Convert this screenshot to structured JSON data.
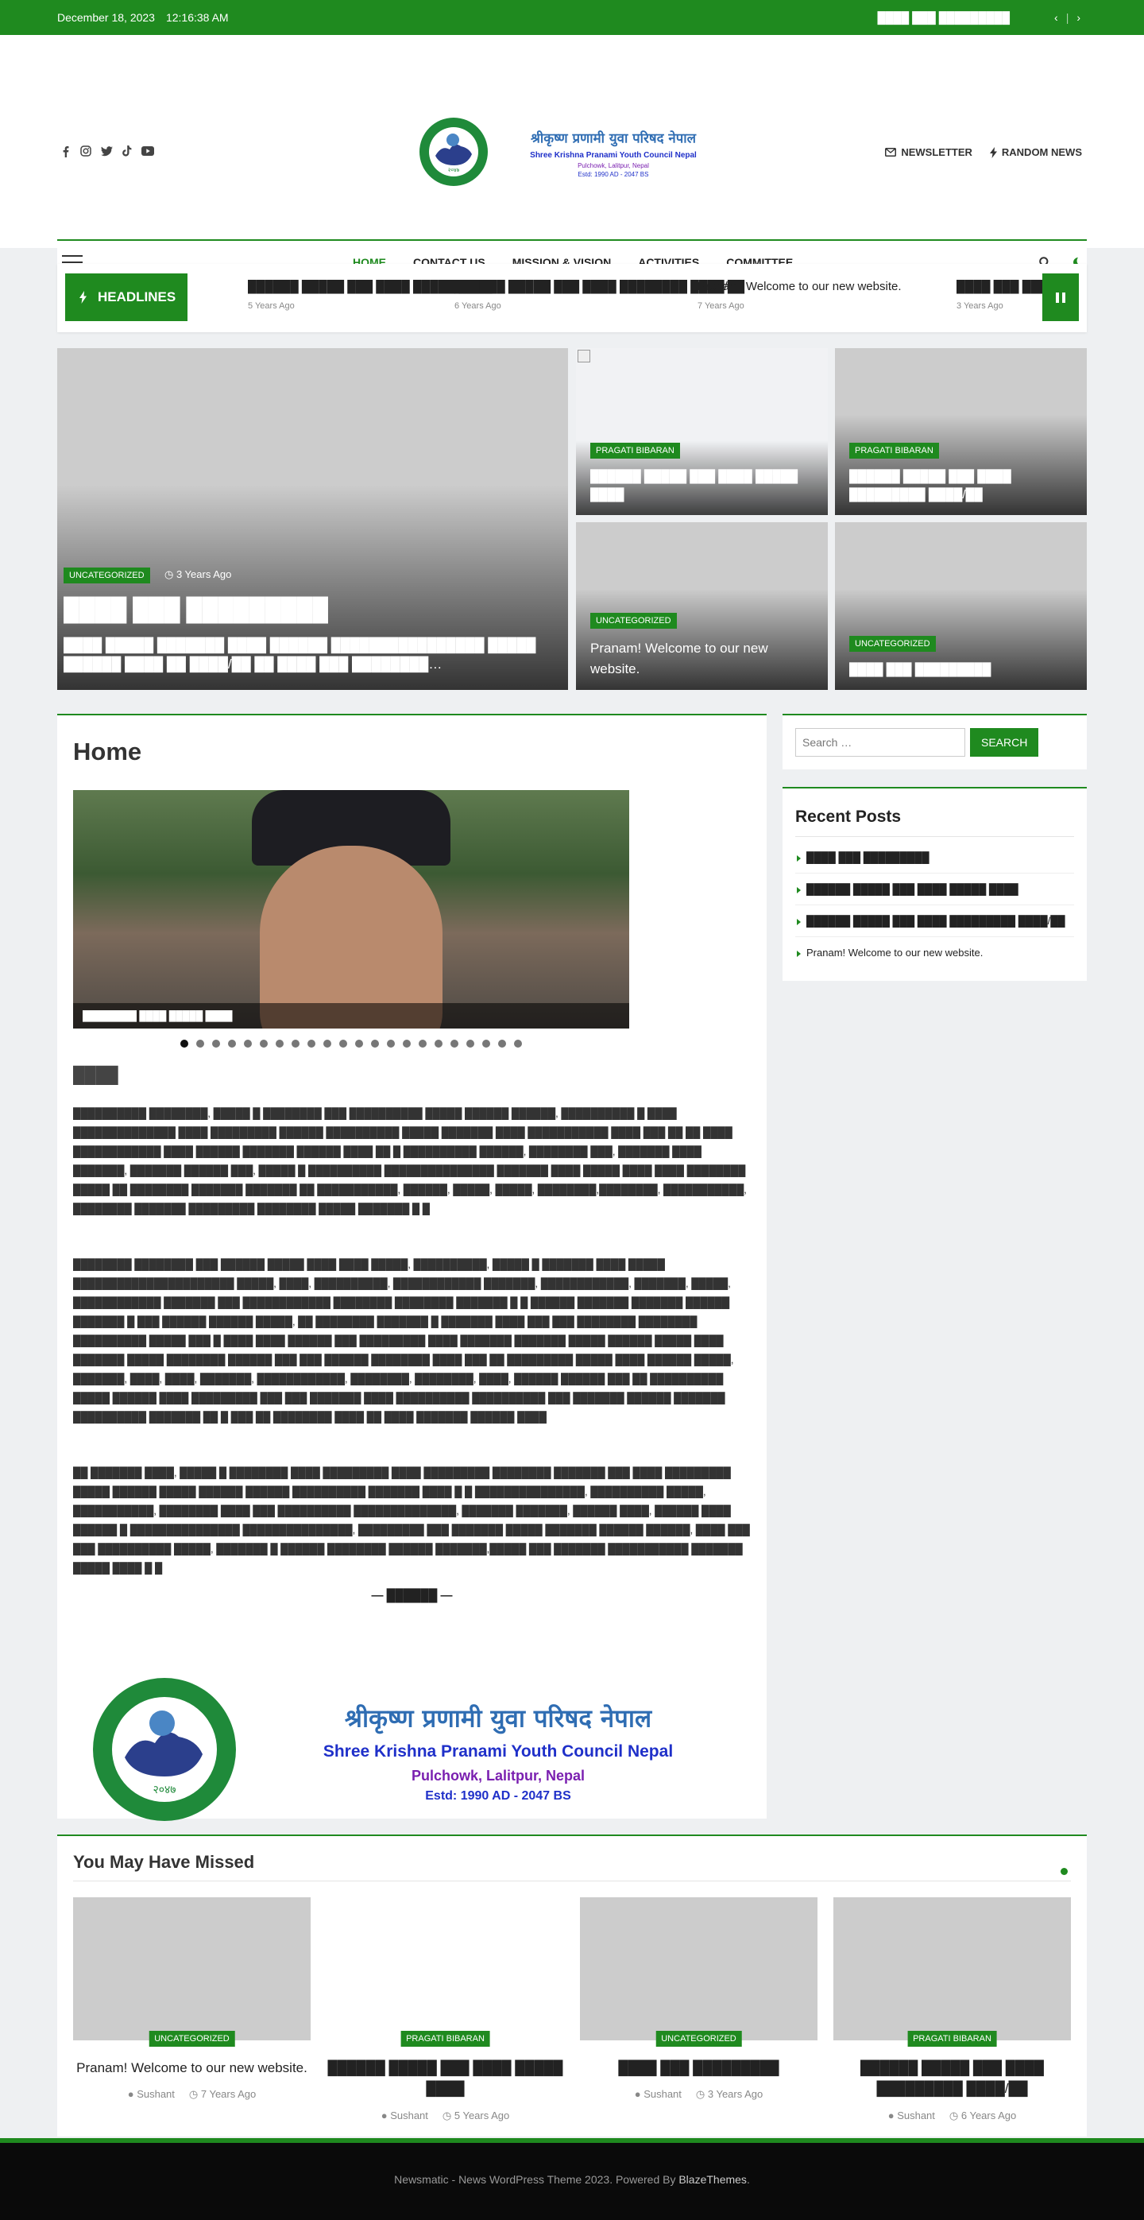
{
  "topbar": {
    "date": "December 18, 2023",
    "time": "12:16:38 AM",
    "ticker_text": "████ ███ █████████"
  },
  "header": {
    "social": [
      "facebook-icon",
      "instagram-icon",
      "twitter-icon",
      "tiktok-icon",
      "youtube-icon"
    ],
    "logo": {
      "title_np": "श्रीकृष्ण प्रणामी युवा परिषद नेपाल",
      "title_en": "Shree Krishna Pranami Youth Council Nepal",
      "address": "Pulchowk, Lalitpur, Nepal",
      "estd": "Estd: 1990 AD - 2047 BS",
      "seal_year": "२०४७"
    },
    "newsletter": "NEWSLETTER",
    "random_news": "RANDOM NEWS"
  },
  "nav": {
    "items": [
      "HOME",
      "CONTACT US",
      "MISSION & VISION",
      "ACTIVITIES",
      "COMMITTEE"
    ]
  },
  "headlines": {
    "label": "HEADLINES",
    "items": [
      {
        "title": "██████ █████ ███ ████ █████ ████",
        "time": "5 Years Ago"
      },
      {
        "title": "██████ █████ ███ ████ ████████ ████/██",
        "time": "6 Years Ago"
      },
      {
        "title": "Pranam! Welcome to our new website.",
        "time": "7 Years Ago"
      },
      {
        "title": "████ ███ ████████",
        "time": "3 Years Ago"
      }
    ]
  },
  "hero": {
    "main": {
      "category": "UNCATEGORIZED",
      "time": "3 Years Ago",
      "title": "████ ███ █████████",
      "excerpt": "████ █████ ███████ ████ ██████ ████████████████ █████ ██████ ████ ██ ████/██ ██ ████ ███ ████████…"
    },
    "cards": [
      {
        "category": "PRAGATI BIBARAN",
        "title": "██████ █████ ███ ████ █████ ████"
      },
      {
        "category": "PRAGATI BIBARAN",
        "title": "██████ █████ ███ ████ █████████ ████/██"
      },
      {
        "category": "UNCATEGORIZED",
        "title": "Pranam! Welcome to our new website."
      },
      {
        "category": "UNCATEGORIZED",
        "title": "████ ███ █████████"
      }
    ]
  },
  "main": {
    "title": "Home",
    "slider_caption": "████████ ████ █████ ████",
    "dot_count": 22,
    "active_dot": 0,
    "subheading": "████",
    "paragraphs": [
      "██████████ ████████, █████ █ ████████ ███ ██████████ █████ ██████ ██████, ██████████ █ ████ ██████████████ ████ █████████ ██████ ██████████ █████ ███████ ████ ███████████ ████ ███ ██ ██ ████ ████████████ ████ ██████ ███████ ██████ ████ ██ █ ██████████ ██████, ████████ ███, ███████ ████ ███████, ███████ ██████ ███, █████ █ ██████████ ███████████████ ███████ ████ █████ ████ ████ ████████ █████ ██ ████████ ███████ ███████ ██ ███████████, ██████, █████, █████, ████████,████████, ███████████, ████████ ███████ █████████ ████████ █████ ███████ █ █",
      "████████ ████████ ███ ██████ █████ ████ ████ █████, ██████████, █████ █ ███████ ████ █████ ██████████████████████ █████, ████, ██████████, ████████████ ███████, ████████████, ███████, █████, ████████████ ███████ ███ ████████████ ████████ ████████ ███████ █ █ ██████ ███████ ███████ ██████ ███████ █ ███ ██████ ██████ █████, ██ ████████ ███████ █ ███████ ████ ███ ███ ████████ ████████ ██████████ █████ ███ █ ████ ████ ██████ ███ █████████ ████ ███████ ███████ █████ ██████ █████ ████ ███████ █████ ████████ ██████ ███ ███ ██████ ████████ ████ ███ ██ █████████ █████ ████ ██████ █████, ███████, ████, ████, ███████, ████████████, ████████, ████████, ████, ██████ ██████ ███ ██ ██████████ █████ ██████ ████ █████████ ███ ███ ███████ ████ ██████████ ██████████ ███ ███████ ██████ ███████ ██████████ ███████ ██ █ ███ ██ ████████ ████ ██ ████ ███████ ██████ ████",
      "██ ███████ ████, █████ █ ████████ ████ █████████ ████ █████████ ████████ ███████ ███ ████ █████████ █████ ██████ █████ ██████ ██████ ██████████ ███████ ████ █ █ ███████████████, ██████████ █████, ███████████, ████████ ████ ███ ██████████ ██████████████, ███████ ███████, ██████ ████, ██████ ████ ██████ █ ███████████████ ███████████████, █████████ ███ ███████ █████ ███████ ██████ ██████, ████ ███ ███ ██████████ █████, ███████ █ ██████ ████████ ██████ ███████,█████ ███ ███████ ███████████ ███████ █████ ████ █ █"
    ],
    "signature": "— ██████ —"
  },
  "sidebar": {
    "search_placeholder": "Search …",
    "search_button": "SEARCH",
    "recent_title": "Recent Posts",
    "recent": [
      "████ ███ █████████",
      "██████ █████ ███ ████ █████ ████",
      "██████ █████ ███ ████ █████████ ████/██",
      "Pranam! Welcome to our new website."
    ]
  },
  "missed": {
    "title": "You May Have Missed",
    "items": [
      {
        "category": "UNCATEGORIZED",
        "title": "Pranam! Welcome to our new website.",
        "author": "Sushant",
        "time": "7 Years Ago",
        "white": false
      },
      {
        "category": "PRAGATI BIBARAN",
        "title": "██████ █████ ███ ████ █████ ████",
        "author": "Sushant",
        "time": "5 Years Ago",
        "white": true
      },
      {
        "category": "UNCATEGORIZED",
        "title": "████ ███ █████████",
        "author": "Sushant",
        "time": "3 Years Ago",
        "white": false
      },
      {
        "category": "PRAGATI BIBARAN",
        "title": "██████ █████ ███ ████ █████████ ████/██",
        "author": "Sushant",
        "time": "6 Years Ago",
        "white": false
      }
    ]
  },
  "footer": {
    "text": "Newsmatic - News WordPress Theme 2023. Powered By ",
    "link": "BlazeThemes",
    "end": "."
  },
  "colors": {
    "accent": "#1f8a1f",
    "title_blue": "#2f6db3",
    "address_purple": "#7a1fb0"
  }
}
